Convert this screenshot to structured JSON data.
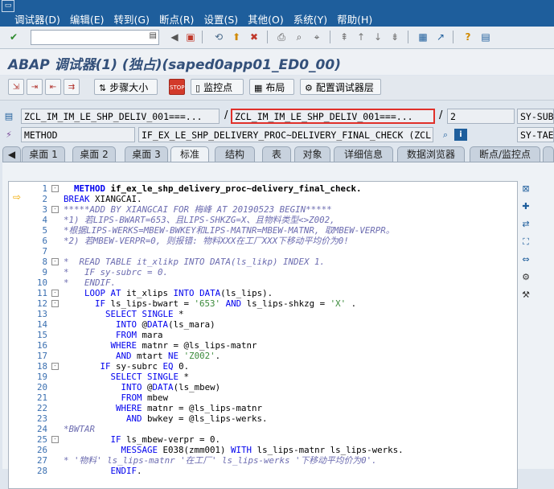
{
  "menu": {
    "items": [
      "调试器(D)",
      "编辑(E)",
      "转到(G)",
      "断点(R)",
      "设置(S)",
      "其他(O)",
      "系统(Y)",
      "帮助(H)"
    ]
  },
  "window": {
    "title": "ABAP 调试器(1) (独占)(saped0app01_ED0_00)"
  },
  "toolbar": {
    "command_value": ""
  },
  "app_toolbar": {
    "step_size_label": "步骤大小",
    "watchpoint_label": "监控点",
    "layout_label": "布局",
    "config_label": "配置调试器层"
  },
  "fields": {
    "row1": {
      "program": "ZCL_IM_IM_LE_SHP_DELIV_001===...",
      "include": "ZCL_IM_IM_LE_SHP_DELIV_001===...",
      "line": "2",
      "sysfield": "SY-SUB"
    },
    "row2": {
      "type": "METHOD",
      "event": "IF_EX_LE_SHP_DELIVERY_PROC~DELIVERY_FINAL_CHECK (ZCL...",
      "sysfield": "SY-TAE"
    }
  },
  "tabs": [
    "桌面 1",
    "桌面 2",
    "桌面 3",
    "标准",
    "结构",
    "表",
    "对象",
    "详细信息",
    "数据浏览器",
    "断点/监控点"
  ],
  "active_tab": "标准",
  "code_lines": [
    {
      "n": "1",
      "fold": "⊟",
      "code": "  METHOD if_ex_le_shp_delivery_proc~delivery_final_check."
    },
    {
      "n": "2",
      "fold": "",
      "code": "BREAK XIANGCAI."
    },
    {
      "n": "3",
      "fold": "⊟",
      "code": "*****ADD BY XIANGCAI FOR 梅峰 AT 20190523 BEGIN*****"
    },
    {
      "n": "4",
      "fold": "",
      "code": "*1) 若LIPS-BWART=653、且LIPS-SHKZG=X、且物料类型<>Z002,"
    },
    {
      "n": "5",
      "fold": "",
      "code": "*根据LIPS-WERKS=MBEW-BWKEY和LIPS-MATNR=MBEW-MATNR, 取MBEW-VERPR。"
    },
    {
      "n": "6",
      "fold": "",
      "code": "*2) 若MBEW-VERPR=0, 则报错: 物料XXX在工厂XXX下移动平均价为0!"
    },
    {
      "n": "7",
      "fold": "",
      "code": ""
    },
    {
      "n": "8",
      "fold": "⊟",
      "code": "*  READ TABLE it_xlikp INTO DATA(ls_likp) INDEX 1."
    },
    {
      "n": "9",
      "fold": "",
      "code": "*   IF sy-subrc = 0."
    },
    {
      "n": "10",
      "fold": "",
      "code": "*   ENDIF."
    },
    {
      "n": "11",
      "fold": "⊟",
      "code": "    LOOP AT it_xlips INTO DATA(ls_lips)."
    },
    {
      "n": "12",
      "fold": "⊟",
      "code": "      IF ls_lips-bwart = '653' AND ls_lips-shkzg = 'X' ."
    },
    {
      "n": "13",
      "fold": "",
      "code": "        SELECT SINGLE *"
    },
    {
      "n": "14",
      "fold": "",
      "code": "          INTO @DATA(ls_mara)"
    },
    {
      "n": "15",
      "fold": "",
      "code": "          FROM mara"
    },
    {
      "n": "16",
      "fold": "",
      "code": "         WHERE matnr = @ls_lips-matnr"
    },
    {
      "n": "17",
      "fold": "",
      "code": "          AND mtart NE 'Z002'."
    },
    {
      "n": "18",
      "fold": "⊟",
      "code": "       IF sy-subrc EQ 0."
    },
    {
      "n": "19",
      "fold": "",
      "code": "         SELECT SINGLE *"
    },
    {
      "n": "20",
      "fold": "",
      "code": "           INTO @DATA(ls_mbew)"
    },
    {
      "n": "21",
      "fold": "",
      "code": "           FROM mbew"
    },
    {
      "n": "22",
      "fold": "",
      "code": "          WHERE matnr = @ls_lips-matnr"
    },
    {
      "n": "23",
      "fold": "",
      "code": "            AND bwkey = @ls_lips-werks."
    },
    {
      "n": "24",
      "fold": "",
      "code": "*BWTAR"
    },
    {
      "n": "25",
      "fold": "⊟",
      "code": "         IF ls_mbew-verpr = 0."
    },
    {
      "n": "26",
      "fold": "",
      "code": "           MESSAGE E038(zmm001) WITH ls_lips-matnr ls_lips-werks."
    },
    {
      "n": "27",
      "fold": "",
      "code": "* '物料' ls_lips-matnr '在工厂' ls_lips-werks '下移动平均价为0'."
    },
    {
      "n": "28",
      "fold": "",
      "code": "         ENDIF."
    }
  ],
  "colors": {
    "menubar": "#1e5e9c",
    "highlight_border": "#e0302a",
    "keyword": "#0000ee",
    "comment": "#6c6cb0",
    "string": "#3a8a3a"
  }
}
